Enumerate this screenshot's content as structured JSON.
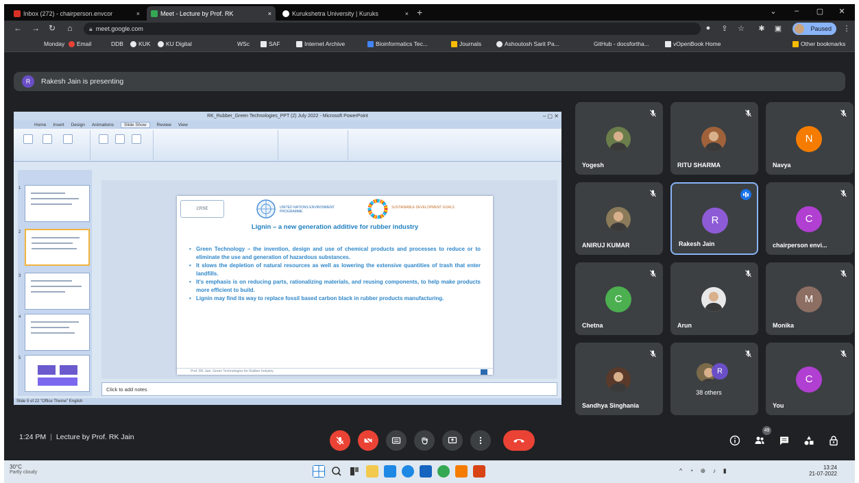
{
  "browser": {
    "tabs": [
      {
        "label": "Inbox (272) - chairperson.envcor",
        "icon_color": "#d93025",
        "active": false
      },
      {
        "label": "Meet - Lecture by Prof. RK",
        "icon_color": "#34a853",
        "active": true
      },
      {
        "label": "Kurukshetra University | Kuruks",
        "icon_color": "#ffffff",
        "active": false
      }
    ],
    "close_glyph": "×",
    "new_tab_glyph": "+",
    "url": "meet.google.com",
    "profile_label": "Paused",
    "bookmarks": [
      {
        "label": "Monday",
        "color": "#9aa0a6"
      },
      {
        "label": "Email",
        "color": "#ea4335"
      },
      {
        "label": "DDB",
        "color": "#9aa0a6"
      },
      {
        "label": "KUK",
        "color": "#e8eaed"
      },
      {
        "label": "KU Digital",
        "color": "#e8eaed"
      },
      {
        "label": "WSc",
        "color": "#9aa0a6"
      },
      {
        "label": "SAF",
        "color": "#e8eaed"
      },
      {
        "label": "Internet Archive",
        "color": "#e8eaed"
      },
      {
        "label": "Bioinformatics Tec...",
        "color": "#4285f4"
      },
      {
        "label": "Journals",
        "color": "#fbbc04"
      },
      {
        "label": "Ashoutosh Sarit Pa...",
        "color": "#e8eaed"
      },
      {
        "label": "GitHub - docsfortha...",
        "color": "#9aa0a6"
      },
      {
        "label": "vOpenBook Home",
        "color": "#e8eaed"
      },
      {
        "label": "Other bookmarks",
        "color": "#fbbc04"
      }
    ]
  },
  "meet": {
    "presenting_initial": "R",
    "presenting_text": "Rakesh Jain is presenting",
    "time": "1:24 PM",
    "meeting_title": "Lecture by Prof. RK Jain",
    "participants": [
      {
        "name": "Yogesh",
        "type": "photo",
        "photo_color": "#6b7d4a"
      },
      {
        "name": "RITU SHARMA",
        "type": "photo",
        "photo_color": "#a0623a"
      },
      {
        "name": "Navya",
        "type": "letter",
        "letter": "N",
        "color": "#f57c00"
      },
      {
        "name": "ANIRUJ KUMAR",
        "type": "photo",
        "photo_color": "#8a7a5a"
      },
      {
        "name": "Rakesh Jain",
        "type": "letter",
        "letter": "R",
        "color": "#8e5bd6",
        "speaking": true
      },
      {
        "name": "chairperson envi...",
        "type": "letter",
        "letter": "C",
        "color": "#b13fd1"
      },
      {
        "name": "Chetna",
        "type": "letter",
        "letter": "C",
        "color": "#4caf50"
      },
      {
        "name": "Arun",
        "type": "photo",
        "photo_color": "#e8e8e8"
      },
      {
        "name": "Monika",
        "type": "letter",
        "letter": "M",
        "color": "#8d6e63"
      },
      {
        "name": "Sandhya Singhania",
        "type": "photo",
        "photo_color": "#5a3a2a"
      },
      {
        "name": "38 others",
        "type": "others",
        "letter": "R",
        "color": "#6a4fc7"
      },
      {
        "name": "You",
        "type": "letter",
        "letter": "C",
        "color": "#b13fd1"
      }
    ],
    "participants_count": "49"
  },
  "powerpoint": {
    "window_title": "RK_Rubber_Green Technologies_PPT (2) July 2022 - Microsoft PowerPoint",
    "ribbon_tabs": [
      "Home",
      "Insert",
      "Design",
      "Animations",
      "Slide Show",
      "Review",
      "View"
    ],
    "active_ribbon_tab": "Slide Show",
    "slide_numbers": [
      "1",
      "2",
      "3",
      "4",
      "5"
    ],
    "slide": {
      "title": "Lignin – a new generation additive for rubber industry",
      "logo1_text": "CRSE",
      "logo2_text": "UNITED NATIONS ENVIRONMENT PROGRAMME",
      "logo3_text": "SUSTAINABLE DEVELOPMENT GOALS",
      "bullets": [
        "Green Technology – the invention, design and use of chemical products and processes to reduce or to eliminate the use and generation of hazardous substances.",
        "It slows the depletion of natural resources as well as lowering the extensive quantities of trash that enter landfills.",
        "It's emphasis is on reducing parts, rationalizing materials, and reusing components, to help make products more efficient to build.",
        "Lignin may find its way to replace fossil based carbon black in rubber products manufacturing."
      ],
      "footer": "Prof. RK Jain, Green Technologies for Rubber Industry"
    },
    "notes_placeholder": "Click to add notes",
    "status": "Slide 5 of 22   \"Office Theme\"   English"
  },
  "taskbar": {
    "weather_temp": "30°C",
    "weather_desc": "Partly cloudy",
    "clock_time": "13:24",
    "clock_date": "21-07-2022",
    "apps": [
      {
        "name": "windows",
        "color": "#1976d2"
      },
      {
        "name": "search",
        "color": "#333333"
      },
      {
        "name": "task-view",
        "color": "#333333"
      },
      {
        "name": "file-explorer",
        "color": "#f2c94c"
      },
      {
        "name": "mail",
        "color": "#1e88e5"
      },
      {
        "name": "edge",
        "color": "#1e88e5"
      },
      {
        "name": "store",
        "color": "#1565c0"
      },
      {
        "name": "chrome",
        "color": "#34a853"
      },
      {
        "name": "office",
        "color": "#f57c00"
      },
      {
        "name": "powerpoint",
        "color": "#d84315"
      }
    ]
  }
}
